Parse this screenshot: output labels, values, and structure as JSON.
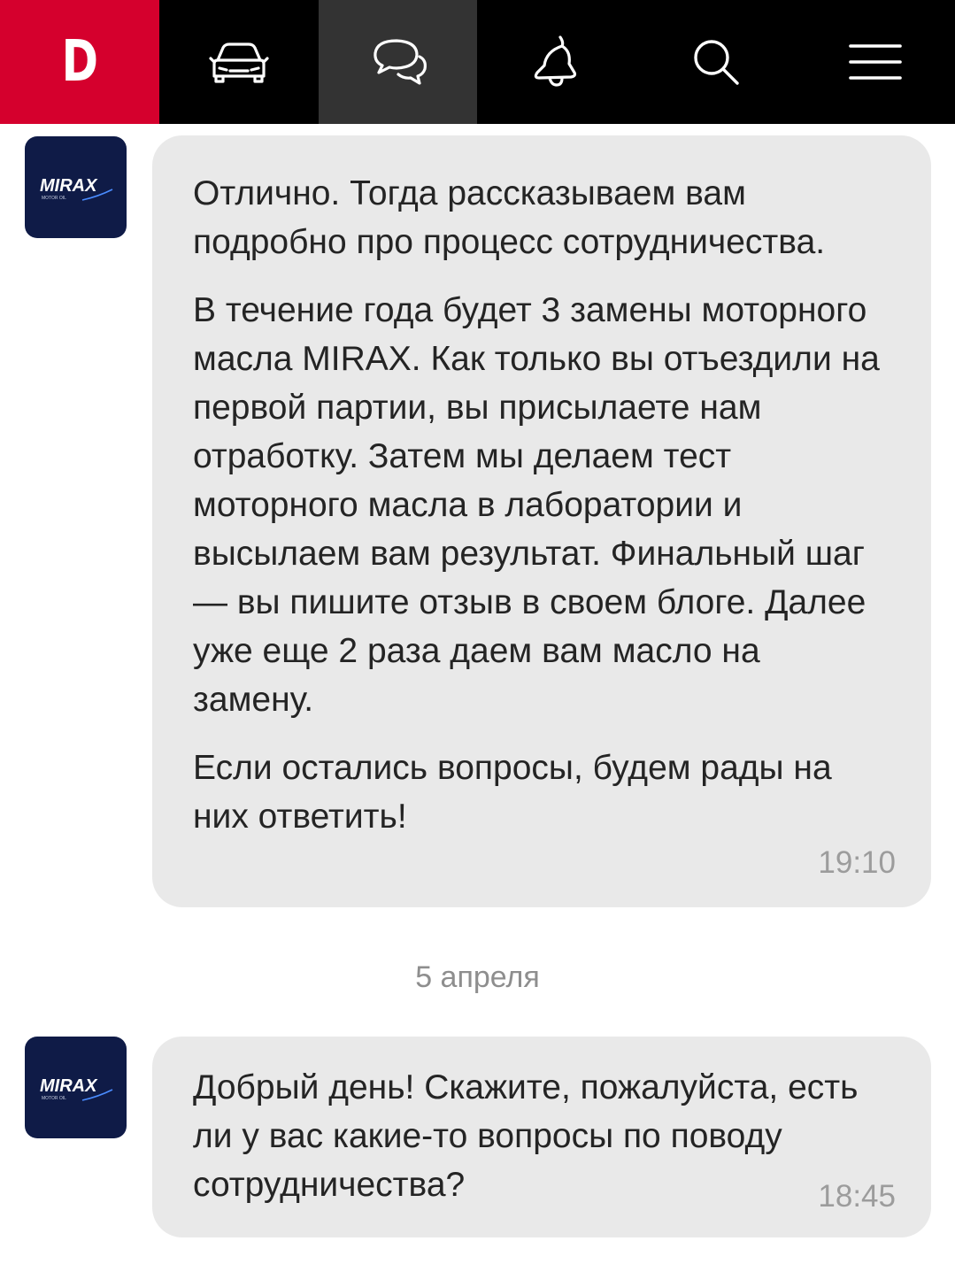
{
  "topbar": {
    "logo_letter": "D",
    "items": [
      {
        "icon": "car-icon"
      },
      {
        "icon": "messages-icon",
        "active": true
      },
      {
        "icon": "bell-icon"
      },
      {
        "icon": "search-icon"
      },
      {
        "icon": "menu-icon"
      }
    ]
  },
  "colors": {
    "brand_red": "#d5002d",
    "topbar_bg": "#000000",
    "active_tab_bg": "#333333",
    "bubble_bg": "#e9e9e9",
    "avatar_bg": "#0f1b47"
  },
  "sender": {
    "brand": "MIRAX",
    "subtitle": "MOTOR OIL"
  },
  "messages": [
    {
      "paragraphs": [
        "Отлично. Тогда рассказываем вам подробно про процесс сотрудничества.",
        "В течение года будет 3 замены моторного масла MIRAX. Как только вы отъездили на первой партии, вы присылаете нам отработку. Затем мы делаем тест моторного масла в лаборатории и высылаем вам результат. Финальный шаг — вы пишите отзыв в своем блоге. Далее уже еще 2 раза даем вам масло на замену.",
        "Если остались вопросы, будем рады на них ответить!"
      ],
      "time": "19:10"
    },
    {
      "paragraphs": [
        "Добрый день! Скажите, пожалуйста, есть ли у вас какие-то вопросы по поводу сотрудничества?"
      ],
      "time": "18:45"
    }
  ],
  "date_separator": "5 апреля"
}
